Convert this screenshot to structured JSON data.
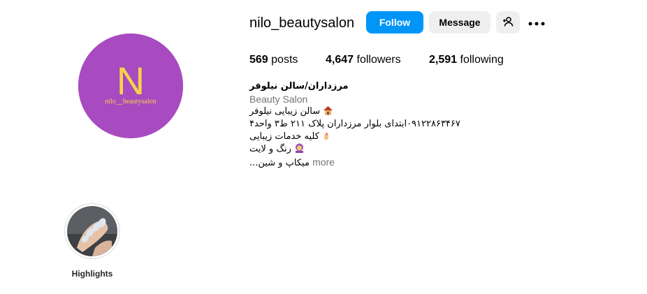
{
  "profile": {
    "username": "nilo_beautysalon",
    "avatar_logo_letter": "N",
    "avatar_logo_text": "nilo__beautysalon",
    "avatar_bg": "#a84ac0",
    "avatar_letter_color": "#f5d34a"
  },
  "actions": {
    "follow_label": "Follow",
    "message_label": "Message",
    "add_user_icon": "person-add-icon",
    "more_icon": "more-options-icon"
  },
  "stats": {
    "posts_count": "569",
    "posts_label": "posts",
    "followers_count": "4,647",
    "followers_label": "followers",
    "following_count": "2,591",
    "following_label": "following"
  },
  "bio": {
    "full_name": "مرزداران/سالن نیلوفر",
    "category": "Beauty Salon",
    "lines": [
      "سالن زیبایی نیلوفر",
      "۰۹۱۲۲۸۶۳۴۶۷ابتدای بلوار مرزداران پلاک ۲۱۱ ط۳ واحد۴",
      "کلیه خدمات زیبایی",
      "رنگ و لایت",
      "میکاپ و شین..."
    ],
    "more_label": "more"
  },
  "highlights": [
    {
      "label": "Highlights"
    }
  ],
  "colors": {
    "primary_button": "#0095f6",
    "secondary_button": "#efefef",
    "muted_text": "#737373"
  }
}
